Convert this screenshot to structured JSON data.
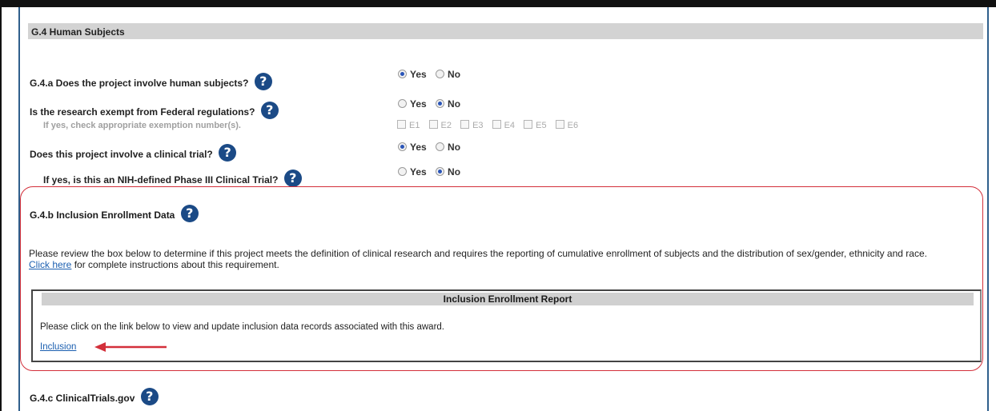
{
  "section": {
    "title": "G.4 Human Subjects"
  },
  "questions": {
    "q1": {
      "label": "G.4.a Does the project involve human subjects?",
      "yes": "Yes",
      "no": "No",
      "selected": "yes"
    },
    "q2": {
      "label": "Is the research exempt from Federal regulations?",
      "yes": "Yes",
      "no": "No",
      "selected": "no",
      "sub_label": "If yes, check appropriate exemption number(s).",
      "exemptions": [
        "E1",
        "E2",
        "E3",
        "E4",
        "E5",
        "E6"
      ]
    },
    "q3": {
      "label": "Does this project involve a clinical trial?",
      "yes": "Yes",
      "no": "No",
      "selected": "yes"
    },
    "q4": {
      "label": "If yes, is this an NIH-defined Phase III Clinical Trial?",
      "yes": "Yes",
      "no": "No",
      "selected": "no"
    }
  },
  "inclusion": {
    "title": "G.4.b Inclusion Enrollment Data",
    "paragraph": "Please review the box below to determine if this project meets the definition of clinical research and requires the reporting of cumulative enrollment of subjects and the distribution of sex/gender, ethnicity and race.",
    "link_text": "Click here",
    "link_suffix": " for complete instructions about this requirement.",
    "report_title": "Inclusion Enrollment Report",
    "report_text": "Please click on the link below to view and update inclusion data records associated with this award.",
    "inclusion_link": "Inclusion"
  },
  "clinicaltrials": {
    "title": "G.4.c ClinicalTrials.gov"
  },
  "help_icon_glyph": "?",
  "colors": {
    "accent_red": "#d32f3a",
    "help_blue": "#1b4a86",
    "link_blue": "#1b5fb0",
    "header_gray": "#d3d3d3"
  }
}
